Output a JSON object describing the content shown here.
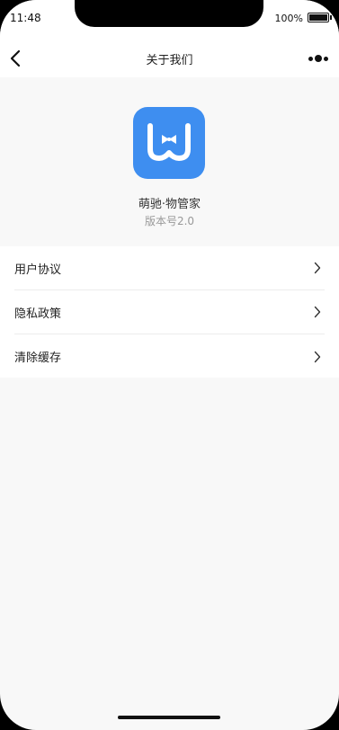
{
  "status_bar": {
    "time": "11:48",
    "battery_percent": "100%"
  },
  "nav": {
    "title": "关于我们",
    "back_icon": "chevron-left-icon",
    "more_icon": "more-dots-icon"
  },
  "app": {
    "name": "萌驰·物管家",
    "version": "版本号2.0",
    "logo_color": "#3e8ef0"
  },
  "menu": {
    "items": [
      {
        "label": "用户协议"
      },
      {
        "label": "隐私政策"
      },
      {
        "label": "清除缓存"
      }
    ]
  }
}
